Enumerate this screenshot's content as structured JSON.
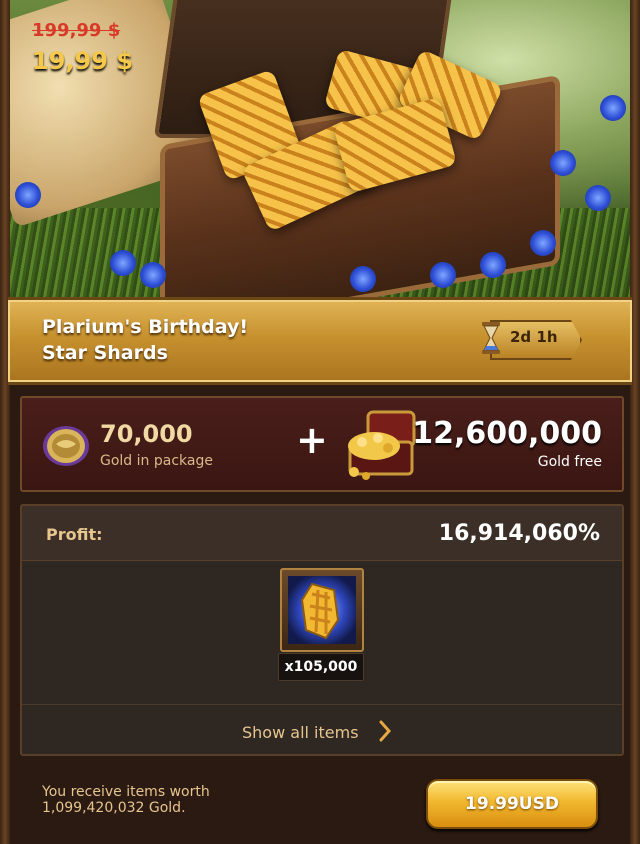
{
  "offer": {
    "old_price": "199,99 $",
    "new_price": "19,99 $",
    "title_line1": "Plarium's Birthday!",
    "title_line2": "Star Shards",
    "timer": "2d 1h"
  },
  "gold": {
    "package_amount": "70,000",
    "package_caption": "Gold in package",
    "plus": "+",
    "free_amount": "12,600,000",
    "free_caption": "Gold free"
  },
  "profit": {
    "label": "Profit:",
    "value": "16,914,060%"
  },
  "items": [
    {
      "icon": "star-shard-icon",
      "quantity": "x105,000"
    }
  ],
  "show_all": {
    "label": "Show all items",
    "icon": "chevron-right-icon"
  },
  "footer": {
    "worth_text_line1": "You receive items worth",
    "worth_text_line2": "1,099,420,032 Gold.",
    "buy_label": "19.99USD"
  },
  "colors": {
    "gold_accent": "#f5c84a",
    "strike_red": "#d83a2a",
    "banner_gold": "#c7912f",
    "panel_maroon": "#4a1e1a",
    "text_tan": "#e7c58e"
  }
}
